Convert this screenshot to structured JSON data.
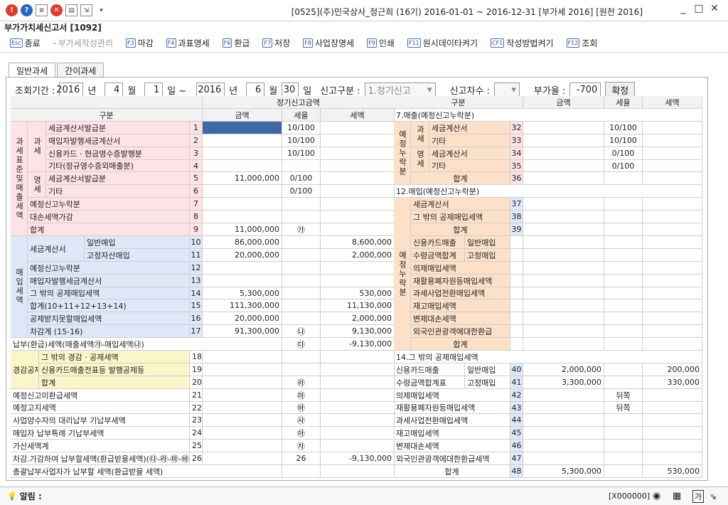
{
  "window": {
    "title": "[0525](주)민국상사_정근희 (16기) 2016-01-01 ~ 2016-12-31 [부가세 2016] [원천 2016]"
  },
  "page_title": "부가가치세신고서 [1092]",
  "toolbar": [
    {
      "key": "Esc",
      "label": "종료",
      "disabled": false
    },
    {
      "key": "",
      "label": "부가세작성관리",
      "disabled": true
    },
    {
      "key": "F3",
      "label": "마감",
      "disabled": false
    },
    {
      "key": "F4",
      "label": "과표명세",
      "disabled": false
    },
    {
      "key": "F6",
      "label": "환급",
      "disabled": false
    },
    {
      "key": "F7",
      "label": "저장",
      "disabled": false
    },
    {
      "key": "F8",
      "label": "사업장명세",
      "disabled": false
    },
    {
      "key": "F9",
      "label": "인쇄",
      "disabled": false
    },
    {
      "key": "F11",
      "label": "원시데이타켜기",
      "disabled": false
    },
    {
      "key": "CF1",
      "label": "작성방법켜기",
      "disabled": false
    },
    {
      "key": "F12",
      "label": "조회",
      "disabled": false
    }
  ],
  "tabs": [
    "일반과세",
    "간이과세"
  ],
  "filter": {
    "period_label": "조회기간 :",
    "y1": "2016",
    "y_unit": "년",
    "m1": "4",
    "m_unit": "월",
    "d1": "1",
    "d_unit": "일 ~",
    "y2": "2016",
    "m2": "6",
    "d2": "30",
    "d_unit2": "일",
    "type_label": "신고구분 :",
    "type_value": "1.정기신고",
    "seq_label": "신고차수 :",
    "rate_label": "부가율 :",
    "rate_value": "-700",
    "confirm": "확정"
  },
  "left": {
    "header_group": "정기신고금액",
    "h_item": "구분",
    "h_amount": "금액",
    "h_rate": "세율",
    "h_tax": "세액",
    "cat_tax": "과세표준및매출세액",
    "cat_in": "매입세액",
    "cat_deduct": "경감공제세액",
    "sub_gwa": "과세",
    "sub_young": "영세",
    "rows": [
      {
        "n": "1",
        "label": "세금계산서발급분",
        "amt": "",
        "rate": "10/100",
        "tax": ""
      },
      {
        "n": "2",
        "label": "매입자발행세금계산서",
        "amt": "",
        "rate": "10/100",
        "tax": ""
      },
      {
        "n": "3",
        "label": "신용카드 · 현금영수증발행분",
        "amt": "",
        "rate": "10/100",
        "tax": ""
      },
      {
        "n": "4",
        "label": "기타(정규영수증외매출분)",
        "amt": "",
        "rate": "",
        "tax": ""
      },
      {
        "n": "5",
        "label": "세금계산서발급분",
        "amt": "11,000,000",
        "rate": "0/100",
        "tax": ""
      },
      {
        "n": "6",
        "label": "기타",
        "amt": "",
        "rate": "0/100",
        "tax": ""
      },
      {
        "n": "7",
        "label": "예정신고누락분",
        "amt": "",
        "rate": "",
        "tax": ""
      },
      {
        "n": "8",
        "label": "대손세액가감",
        "amt": "",
        "rate": "",
        "tax": ""
      },
      {
        "n": "9",
        "label": "합계",
        "amt": "11,000,000",
        "rate": "㉮",
        "tax": ""
      },
      {
        "n": "10",
        "label": "일반매입",
        "amt": "86,000,000",
        "rate": "",
        "tax": "8,600,000"
      },
      {
        "n": "11",
        "label": "고정자산매입",
        "amt": "20,000,000",
        "rate": "",
        "tax": "2,000,000"
      },
      {
        "n": "12",
        "label": "예정신고누락분",
        "amt": "",
        "rate": "",
        "tax": ""
      },
      {
        "n": "13",
        "label": "매입자발행세금계산서",
        "amt": "",
        "rate": "",
        "tax": ""
      },
      {
        "n": "14",
        "label": "그 밖의 공제매입세액",
        "amt": "5,300,000",
        "rate": "",
        "tax": "530,000"
      },
      {
        "n": "15",
        "label": "합계(10+11+12+13+14)",
        "amt": "111,300,000",
        "rate": "",
        "tax": "11,130,000"
      },
      {
        "n": "16",
        "label": "공제받지못할매입세액",
        "amt": "20,000,000",
        "rate": "",
        "tax": "2,000,000"
      },
      {
        "n": "17",
        "label": "차감계 (15-16)",
        "amt": "91,300,000",
        "rate": "㉯",
        "tax": "9,130,000"
      }
    ],
    "inv_label": "세금계산서",
    "inv_label2": "수취분",
    "payable": {
      "label": "납부(환급)세액(매출세액㉮-매입세액㉯)",
      "rate": "㉰",
      "tax": "-9,130,000"
    },
    "rows2": [
      {
        "n": "18",
        "label": "그 밖의 경감 · 공제세액",
        "rate": ""
      },
      {
        "n": "19",
        "label": "신용카드매출전표등 발행공제등",
        "rate": ""
      },
      {
        "n": "20",
        "label": "합계",
        "rate": "㉱"
      },
      {
        "n": "21",
        "label": "예정신고미환급세액",
        "rate": "㉲"
      },
      {
        "n": "22",
        "label": "예정고지세액",
        "rate": "㉳"
      },
      {
        "n": "23",
        "label": "사업양수자의 대리납부 기납부세액",
        "rate": "㉴"
      },
      {
        "n": "24",
        "label": "매입자 납부특례 기납부세액",
        "rate": "㉵"
      },
      {
        "n": "25",
        "label": "가산세액계",
        "rate": "㉶"
      },
      {
        "n": "26",
        "label": "차감.가감하여 납부할세액(환급받을세액)(㉰-㉱-㉲-㉳-㉴-㉵+㉶)",
        "rate": "",
        "tax": "-9,130,000"
      },
      {
        "n": "",
        "label": "총괄납부사업자가 납부할 세액(환급받을 세액)",
        "rate": "",
        "tax": ""
      }
    ]
  },
  "right": {
    "h_item": "구분",
    "h_amount": "금액",
    "h_rate": "세율",
    "h_tax": "세액",
    "sec7": "7.매출(예정신고누락분)",
    "sec12": "12.매입(예정신고누락분)",
    "sec14": "14.그 밖의 공제매입세액",
    "cat_pre": "예정누락분",
    "cat_pre2": "예정누락분",
    "sub_gwa": "과세",
    "sub_young": "영세",
    "r7": [
      {
        "n": "32",
        "label": "세금계산서",
        "rate": "10/100"
      },
      {
        "n": "33",
        "label": "기타",
        "rate": "10/100"
      },
      {
        "n": "34",
        "label": "세금계산서",
        "rate": "0/100"
      },
      {
        "n": "35",
        "label": "기타",
        "rate": "0/100"
      },
      {
        "n": "36",
        "label": "합계",
        "rate": ""
      }
    ],
    "r12": [
      {
        "n": "37",
        "label": "세금계산서"
      },
      {
        "n": "38",
        "label": "그 밖의 공제매입세액"
      },
      {
        "n": "39",
        "label": "합계"
      }
    ],
    "r12b": [
      {
        "label": "신용카드매출",
        "label2": "일반매입"
      },
      {
        "label": "수령금액합계",
        "label2": "고정매입"
      },
      {
        "label": "의제매입세액",
        "label2": ""
      },
      {
        "label": "재활용폐자원등매입세액",
        "label2": ""
      },
      {
        "label": "과세사업전환매입세액",
        "label2": ""
      },
      {
        "label": "재고매입세액",
        "label2": ""
      },
      {
        "label": "변제대손세액",
        "label2": ""
      },
      {
        "label": "외국인관광객에대한환급",
        "label2": ""
      },
      {
        "label": "합계",
        "label2": ""
      }
    ],
    "r14": [
      {
        "n": "40",
        "label": "신용카드매출",
        "label2": "일반매입",
        "amt": "2,000,000",
        "rate": "",
        "tax": "200,000"
      },
      {
        "n": "41",
        "label": "수령금액합계표",
        "label2": "고정매입",
        "amt": "3,300,000",
        "rate": "",
        "tax": "330,000"
      },
      {
        "n": "42",
        "label": "의제매입세액",
        "label2": "",
        "amt": "",
        "rate": "뒤쪽",
        "tax": ""
      },
      {
        "n": "43",
        "label": "재활용폐자원등매입세액",
        "label2": "",
        "amt": "",
        "rate": "뒤쪽",
        "tax": ""
      },
      {
        "n": "44",
        "label": "과세사업전환매입세액",
        "label2": "",
        "amt": "",
        "rate": "",
        "tax": ""
      },
      {
        "n": "45",
        "label": "재고매입세액",
        "label2": "",
        "amt": "",
        "rate": "",
        "tax": ""
      },
      {
        "n": "46",
        "label": "변제대손세액",
        "label2": "",
        "amt": "",
        "rate": "",
        "tax": ""
      },
      {
        "n": "47",
        "label": "외국인관광객에대한환급세액",
        "label2": "",
        "amt": "",
        "rate": "",
        "tax": ""
      },
      {
        "n": "48",
        "label": "합계",
        "label2": "",
        "amt": "5,300,000",
        "rate": "",
        "tax": "530,000"
      }
    ]
  },
  "status": {
    "label": "알림 :",
    "code": "[X000000]",
    "lang": "가"
  }
}
